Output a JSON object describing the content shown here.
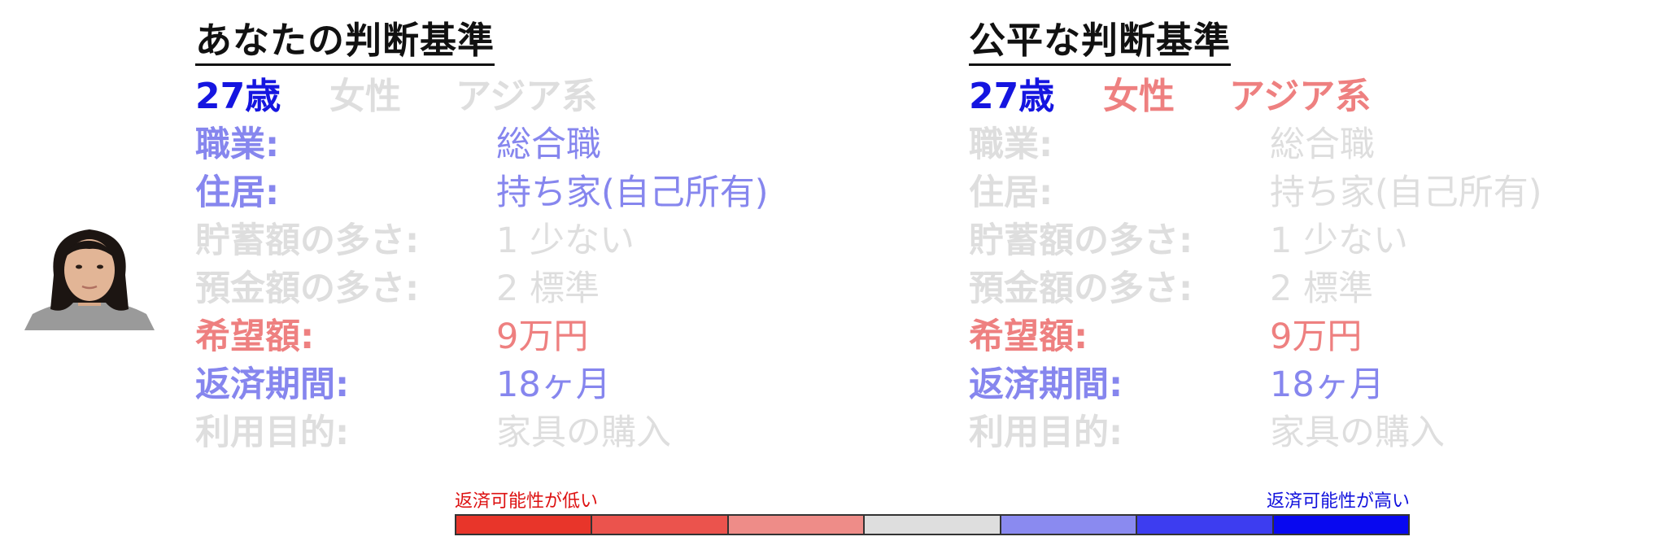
{
  "left_panel": {
    "title": "あなたの判断基準",
    "demographics": {
      "age": "27歳",
      "gender": "女性",
      "ethnicity": "アジア系"
    },
    "attributes": [
      {
        "label": "職業:",
        "value": "総合職"
      },
      {
        "label": "住居:",
        "value": "持ち家(自己所有)"
      },
      {
        "label": "貯蓄額の多さ:",
        "value": "1 少ない"
      },
      {
        "label": "預金額の多さ:",
        "value": "2 標準"
      },
      {
        "label": "希望額:",
        "value": "9万円"
      },
      {
        "label": "返済期間:",
        "value": "18ヶ月"
      },
      {
        "label": "利用目的:",
        "value": "家具の購入"
      }
    ]
  },
  "right_panel": {
    "title": "公平な判断基準",
    "demographics": {
      "age": "27歳",
      "gender": "女性",
      "ethnicity": "アジア系"
    },
    "attributes": [
      {
        "label": "職業:",
        "value": "総合職"
      },
      {
        "label": "住居:",
        "value": "持ち家(自己所有)"
      },
      {
        "label": "貯蓄額の多さ:",
        "value": "1 少ない"
      },
      {
        "label": "預金額の多さ:",
        "value": "2 標準"
      },
      {
        "label": "希望額:",
        "value": "9万円"
      },
      {
        "label": "返済期間:",
        "value": "18ヶ月"
      },
      {
        "label": "利用目的:",
        "value": "家具の購入"
      }
    ]
  },
  "legend": {
    "low_label": "返済可能性が低い",
    "high_label": "返済可能性が高い",
    "colors": [
      "#e8352a",
      "#eb534d",
      "#ee8c88",
      "#dedede",
      "#8a8af0",
      "#3d3df0",
      "#0808f0"
    ]
  },
  "colors": {
    "strong_blue": "#1515e0",
    "light_blue": "#8686ee",
    "light_red": "#ee8080",
    "inactive_gray": "#dedede"
  }
}
